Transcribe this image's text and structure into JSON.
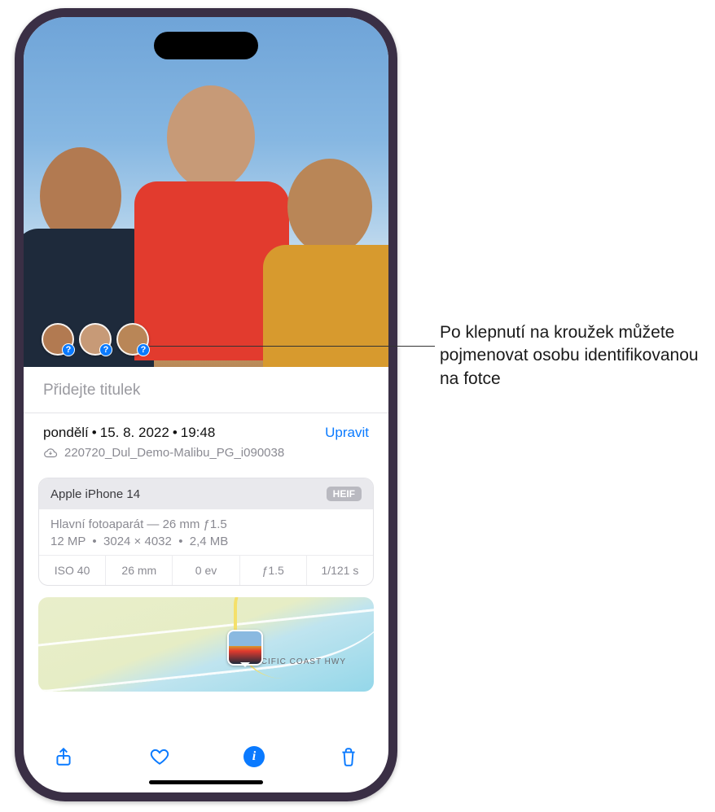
{
  "callout": "Po klepnutí na kroužek můžete pojmenovat osobu identifikovanou na fotce",
  "caption_placeholder": "Přidejte titulek",
  "meta": {
    "day": "pondělí",
    "date": "15. 8. 2022",
    "time": "19:48",
    "edit": "Upravit",
    "filename": "220720_Dul_Demo-Malibu_PG_i090038"
  },
  "camera": {
    "device": "Apple iPhone 14",
    "format_badge": "HEIF",
    "lens": "Hlavní fotoaparát — 26 mm ƒ1.5",
    "mp": "12 MP",
    "dims": "3024 × 4032",
    "size": "2,4 MB",
    "specs": {
      "iso": "ISO 40",
      "focal": "26 mm",
      "ev": "0 ev",
      "aperture": "ƒ1.5",
      "shutter": "1/121 s"
    }
  },
  "map": {
    "road_label": "PACIFIC COAST HWY"
  },
  "icons": {
    "share": "share-icon",
    "favorite": "heart-icon",
    "info": "info-icon",
    "trash": "trash-icon",
    "cloud": "cloud-icon"
  }
}
